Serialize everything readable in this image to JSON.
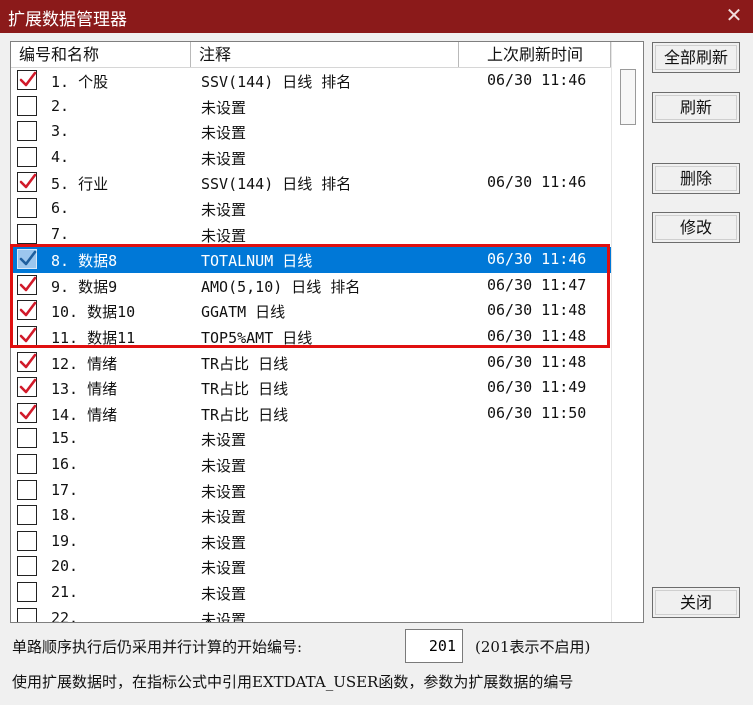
{
  "window": {
    "title": "扩展数据管理器",
    "close_glyph": "✕"
  },
  "columns": {
    "name": "编号和名称",
    "note": "注释",
    "time": "上次刷新时间"
  },
  "rows": [
    {
      "checked": true,
      "name": "1. 个股",
      "note": "SSV(144) 日线 排名",
      "time": "06/30 11:46"
    },
    {
      "checked": false,
      "name": "2.",
      "note": "未设置",
      "time": ""
    },
    {
      "checked": false,
      "name": "3.",
      "note": "未设置",
      "time": ""
    },
    {
      "checked": false,
      "name": "4.",
      "note": "未设置",
      "time": ""
    },
    {
      "checked": true,
      "name": "5. 行业",
      "note": "SSV(144) 日线 排名",
      "time": "06/30 11:46"
    },
    {
      "checked": false,
      "name": "6.",
      "note": "未设置",
      "time": ""
    },
    {
      "checked": false,
      "name": "7.",
      "note": "未设置",
      "time": ""
    },
    {
      "checked": true,
      "name": "8. 数据8",
      "note": "TOTALNUM 日线",
      "time": "06/30 11:46",
      "selected": true
    },
    {
      "checked": true,
      "name": "9. 数据9",
      "note": "AMO(5,10) 日线 排名",
      "time": "06/30 11:47"
    },
    {
      "checked": true,
      "name": "10. 数据10",
      "note": "GGATM 日线",
      "time": "06/30 11:48"
    },
    {
      "checked": true,
      "name": "11. 数据11",
      "note": "TOP5%AMT 日线",
      "time": "06/30 11:48"
    },
    {
      "checked": true,
      "name": "12. 情绪",
      "note": "TR占比 日线",
      "time": "06/30 11:48"
    },
    {
      "checked": true,
      "name": "13. 情绪",
      "note": "TR占比 日线",
      "time": "06/30 11:49"
    },
    {
      "checked": true,
      "name": "14. 情绪",
      "note": "TR占比 日线",
      "time": "06/30 11:50"
    },
    {
      "checked": false,
      "name": "15.",
      "note": "未设置",
      "time": ""
    },
    {
      "checked": false,
      "name": "16.",
      "note": "未设置",
      "time": ""
    },
    {
      "checked": false,
      "name": "17.",
      "note": "未设置",
      "time": ""
    },
    {
      "checked": false,
      "name": "18.",
      "note": "未设置",
      "time": ""
    },
    {
      "checked": false,
      "name": "19.",
      "note": "未设置",
      "time": ""
    },
    {
      "checked": false,
      "name": "20.",
      "note": "未设置",
      "time": ""
    },
    {
      "checked": false,
      "name": "21.",
      "note": "未设置",
      "time": ""
    },
    {
      "checked": false,
      "name": "22.",
      "note": "未设置",
      "time": ""
    }
  ],
  "buttons": {
    "refresh_all": "全部刷新",
    "refresh": "刷新",
    "delete": "删除",
    "modify": "修改",
    "close": "关闭"
  },
  "footer": {
    "start_label": "单路顺序执行后仍采用并行计算的开始编号:",
    "start_value": "201",
    "start_hint": "(201表示不启用)",
    "usage_note": "使用扩展数据时，在指标公式中引用EXTDATA_USER函数，参数为扩展数据的编号"
  },
  "colors": {
    "titlebar": "#8b1a1a",
    "selection": "#0078d7",
    "check": "#d11a2a",
    "highlight_box": "#e01010"
  }
}
